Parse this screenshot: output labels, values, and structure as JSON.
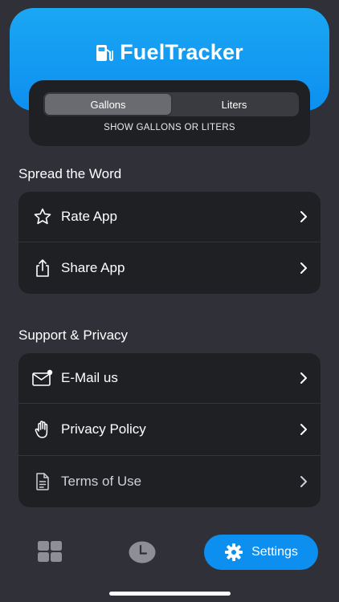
{
  "brand": {
    "name_part1": "Fuel",
    "name_part2": "Tracker",
    "accent": "#0d8ff0"
  },
  "unit_toggle": {
    "options": [
      "Gallons",
      "Liters"
    ],
    "selected": "Gallons",
    "caption": "SHOW GALLONS OR LITERS"
  },
  "spread": {
    "title": "Spread the Word",
    "items": [
      {
        "label": "Rate App",
        "icon": "star-icon"
      },
      {
        "label": "Share App",
        "icon": "share-icon"
      }
    ]
  },
  "support": {
    "title": "Support & Privacy",
    "items": [
      {
        "label": "E-Mail us",
        "icon": "mail-icon"
      },
      {
        "label": "Privacy Policy",
        "icon": "hand-icon"
      },
      {
        "label": "Terms of Use",
        "icon": "document-icon"
      }
    ]
  },
  "tabbar": {
    "settings_label": "Settings",
    "tabs": [
      "grid-icon",
      "clock-icon",
      "gear-icon"
    ]
  }
}
